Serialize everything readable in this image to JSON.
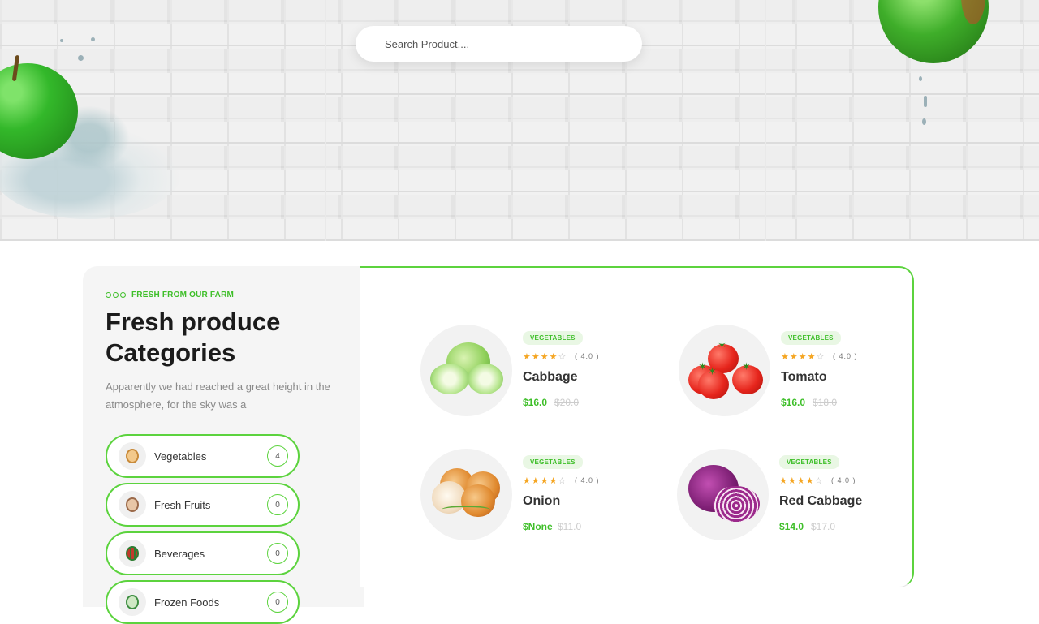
{
  "search": {
    "placeholder": "Search Product...."
  },
  "categories_section": {
    "eyebrow": "FRESH FROM OUR FARM",
    "title": "Fresh produce Categories",
    "description": "Apparently we had reached a great height in the atmosphere, for the sky was a",
    "items": [
      {
        "label": "Vegetables",
        "count": "4"
      },
      {
        "label": "Fresh Fruits",
        "count": "0"
      },
      {
        "label": "Beverages",
        "count": "0"
      },
      {
        "label": "Frozen Foods",
        "count": "0"
      }
    ]
  },
  "products": [
    {
      "tag": "VEGETABLES",
      "rating": "( 4.0 )",
      "stars": 4,
      "name": "Cabbage",
      "price": "$16.0",
      "old_price": "$20.0"
    },
    {
      "tag": "VEGETABLES",
      "rating": "( 4.0 )",
      "stars": 4,
      "name": "Tomato",
      "price": "$16.0",
      "old_price": "$18.0"
    },
    {
      "tag": "VEGETABLES",
      "rating": "( 4.0 )",
      "stars": 4,
      "name": "Onion",
      "price": "$None",
      "old_price": "$11.0"
    },
    {
      "tag": "VEGETABLES",
      "rating": "( 4.0 )",
      "stars": 4,
      "name": "Red Cabbage",
      "price": "$14.0",
      "old_price": "$17.0"
    }
  ],
  "colors": {
    "accent": "#3fbf2a",
    "border": "#5cd33e",
    "star": "#f5a623"
  }
}
